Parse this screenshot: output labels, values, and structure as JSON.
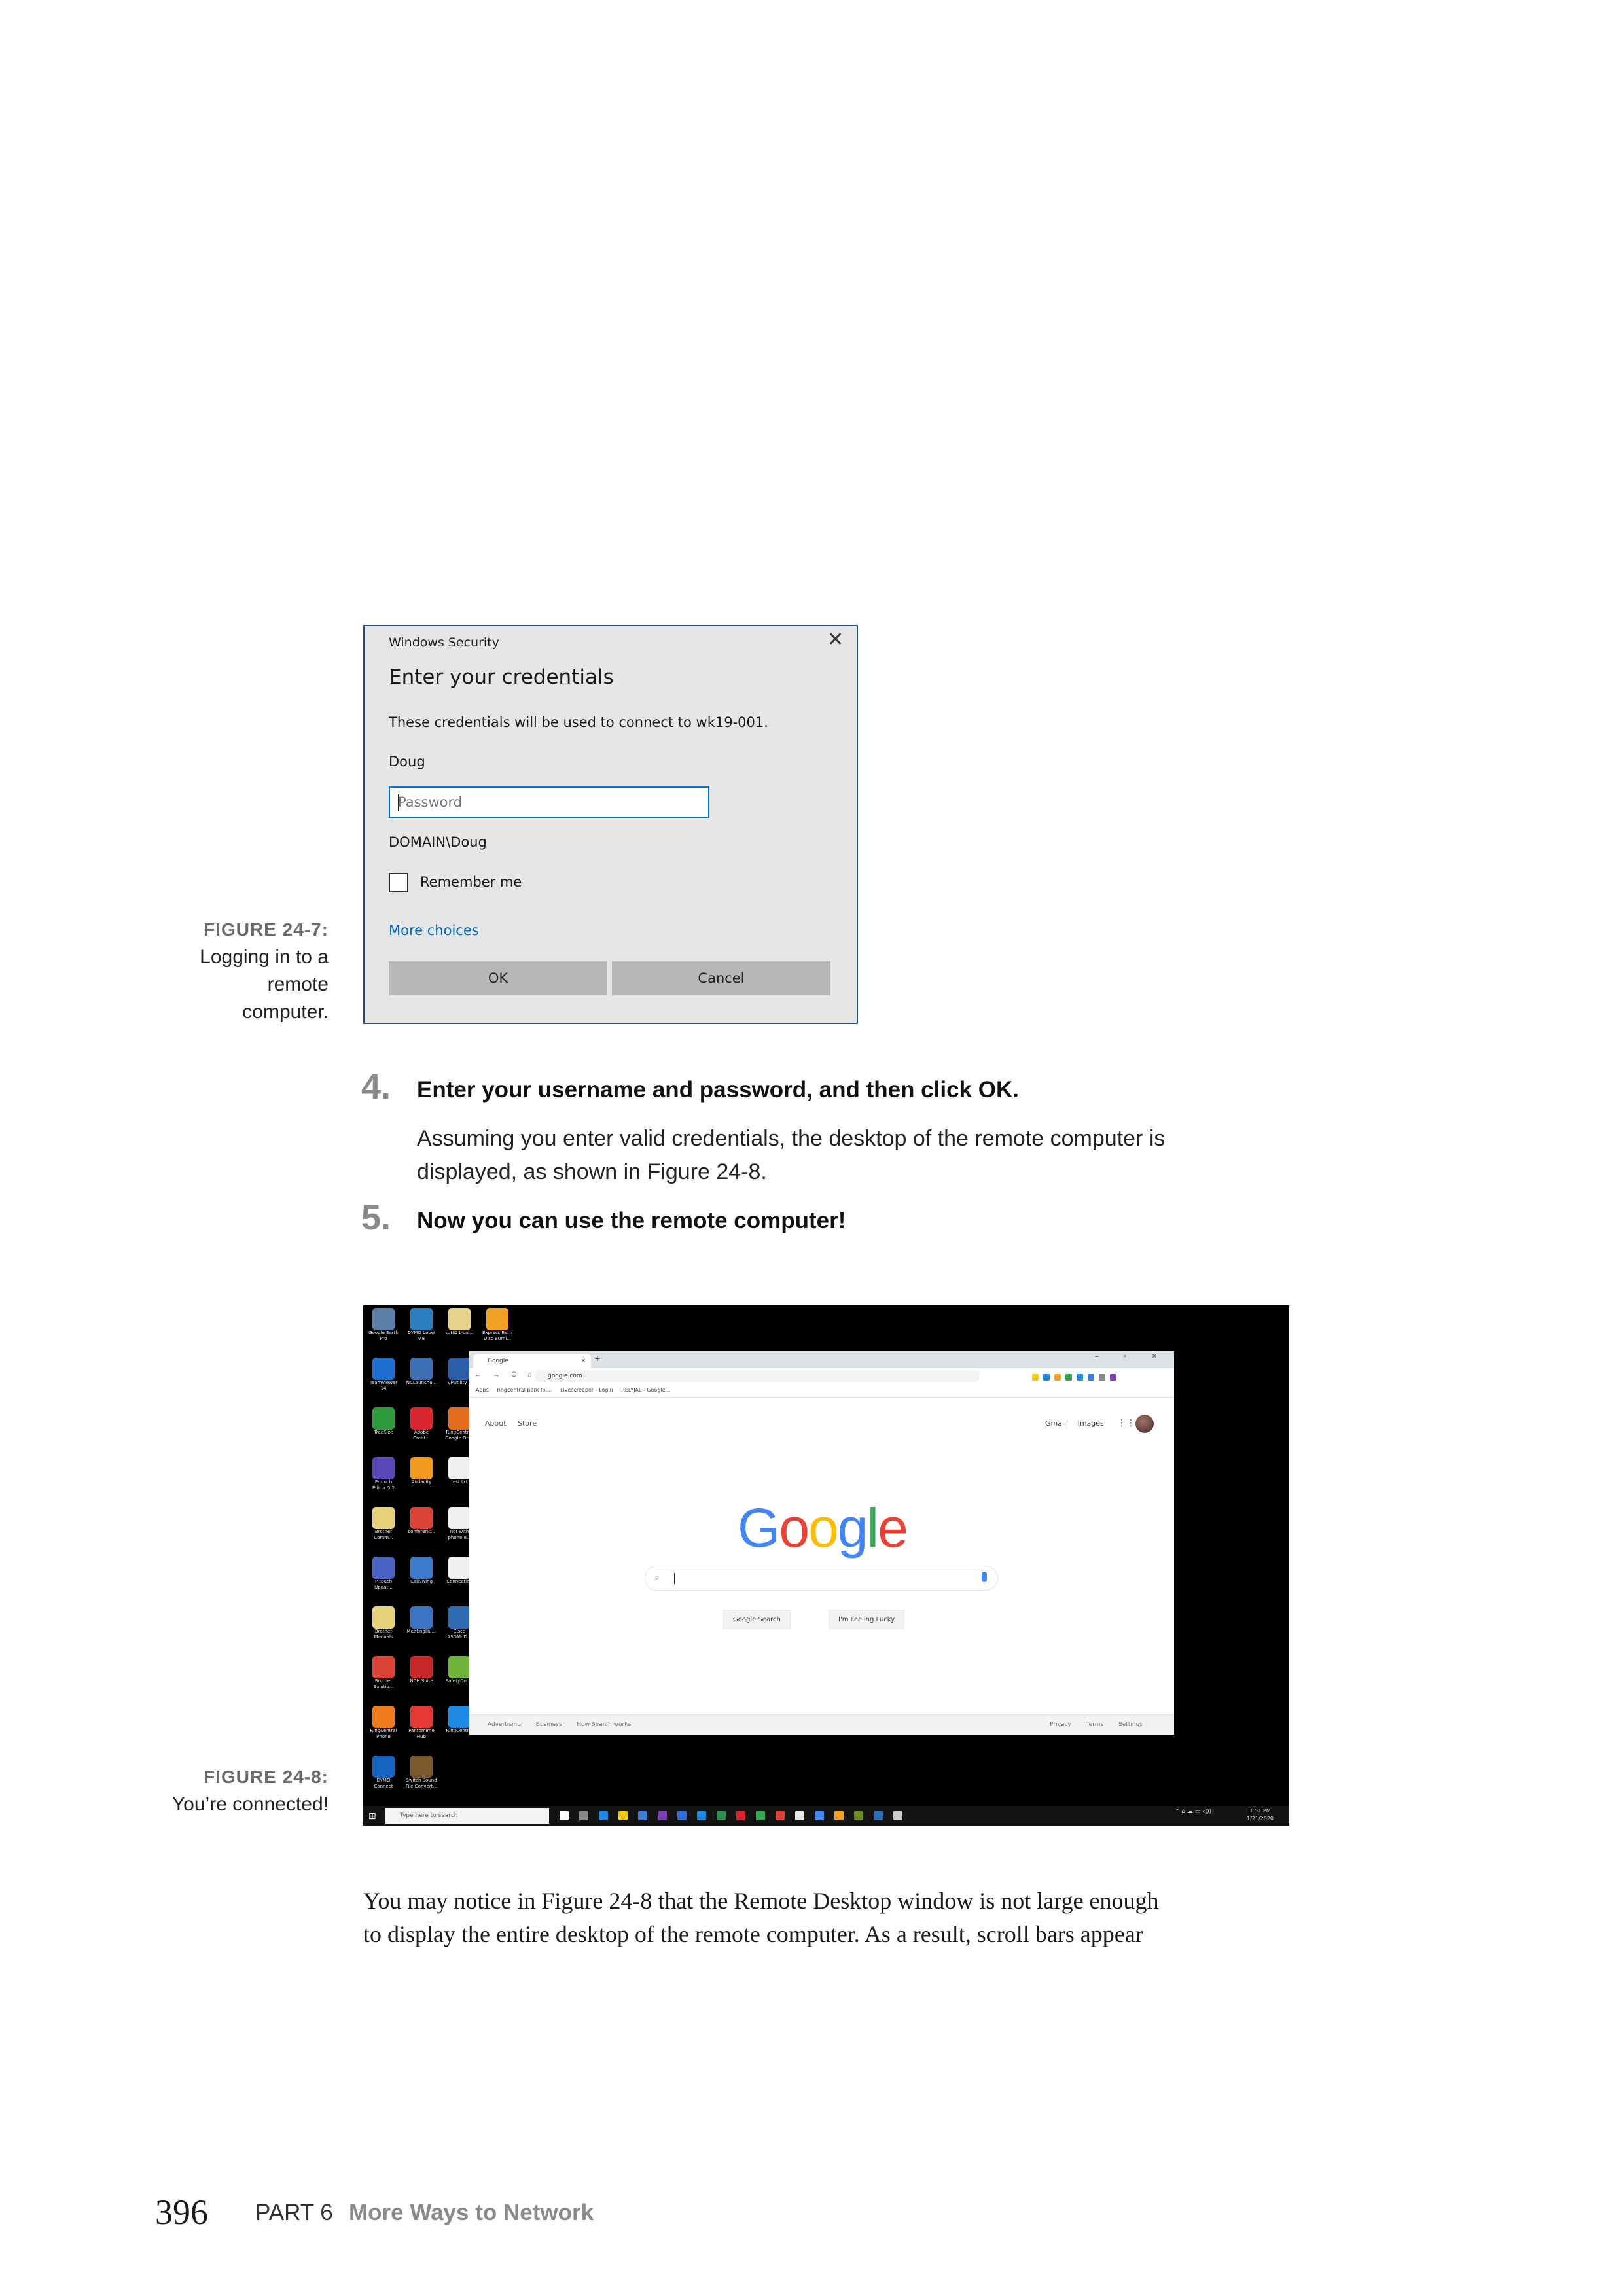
{
  "figure_24_7": {
    "label": "FIGURE 24-7:",
    "caption_lines": [
      "Logging in to a",
      "remote",
      "computer."
    ],
    "dialog": {
      "title": "Windows Security",
      "close_glyph": "✕",
      "heading": "Enter your credentials",
      "description": "These credentials will be used to connect to wk19-001.",
      "username": "Doug",
      "password_placeholder": "Password",
      "domain_user": "DOMAIN\\Doug",
      "remember_label": "Remember me",
      "more_choices": "More choices",
      "ok_label": "OK",
      "cancel_label": "Cancel"
    }
  },
  "steps": [
    {
      "num": "4.",
      "text": "Enter your username and password, and then click OK.",
      "detail_lines": [
        "Assuming you enter valid credentials, the desktop of the remote computer is",
        "displayed, as shown in Figure 24-8."
      ]
    },
    {
      "num": "5.",
      "text": "Now you can use the remote computer!"
    }
  ],
  "figure_24_8": {
    "label": "FIGURE 24-8:",
    "caption": "You’re connected!",
    "desktop_icons": [
      {
        "label": "Google Earth\nPro",
        "color": "#5b7fa8"
      },
      {
        "label": "DYMO Label\nv.8",
        "color": "#2e7fc2"
      },
      {
        "label": "sqt021-cal...",
        "color": "#e6d38a"
      },
      {
        "label": "Express Burn\nDisc Burni...",
        "color": "#f2a127"
      },
      {
        "label": "TeamViewer\n14",
        "color": "#1f6fd1"
      },
      {
        "label": "NCLaunche...",
        "color": "#3d6fb5"
      },
      {
        "label": "VPUtility 2",
        "color": "#2b5ea8"
      },
      {
        "label": "TreeSize",
        "color": "#2e9b3c"
      },
      {
        "label": "Adobe\nCreat...",
        "color": "#d9262e"
      },
      {
        "label": "RingCentral\nGoogle Dri...",
        "color": "#e36f1e"
      },
      {
        "label": "P-touch\nEditor 5.2",
        "color": "#5b48b8"
      },
      {
        "label": "Audacity",
        "color": "#f29a1d"
      },
      {
        "label": "test.txt",
        "color": "#f0f0f0"
      },
      {
        "label": "Brother\nComm...",
        "color": "#e8d27a"
      },
      {
        "label": "conferenc...",
        "color": "#db4437"
      },
      {
        "label": "not with\nphone e...",
        "color": "#f0f0f0"
      },
      {
        "label": "P-touch\nUpdat...",
        "color": "#4a62c4"
      },
      {
        "label": "CallSwing",
        "color": "#3d7ac9"
      },
      {
        "label": "Connection",
        "color": "#f0f0f0"
      },
      {
        "label": "Brother\nManuals",
        "color": "#e8d27a"
      },
      {
        "label": "MeetingHu...",
        "color": "#3a74c2"
      },
      {
        "label": "Cisco\nASDM-ID...",
        "color": "#2e6bb2"
      },
      {
        "label": "Brother\nSolutio...",
        "color": "#db4437"
      },
      {
        "label": "NCH Suite",
        "color": "#c62828"
      },
      {
        "label": "SafetyDoc...",
        "color": "#6fb33a"
      },
      {
        "label": "RingCentral\nPhone",
        "color": "#f07c1e"
      },
      {
        "label": "Pantomime\nHub",
        "color": "#e53935"
      },
      {
        "label": "RingCentral",
        "color": "#1e88e5"
      },
      {
        "label": "DYMO\nConnect",
        "color": "#1565c0"
      },
      {
        "label": "Switch Sound\nFile Convert...",
        "color": "#7d5a2e"
      }
    ],
    "browser": {
      "tab_label": "Google",
      "tab_close": "×",
      "new_tab": "+",
      "window_controls": "– ▫ ✕",
      "nav": "← → C ⌂",
      "url": "google.com",
      "bookmarks": [
        "Apps",
        "ringcentral park fol...",
        "Livescreeper - Login",
        "RELYJAL - Google..."
      ],
      "top_left_links": [
        "About",
        "Store"
      ],
      "top_right_links": [
        "Gmail",
        "Images"
      ],
      "apps_glyph": "⋮⋮⋮",
      "logo_letters": [
        {
          "ch": "G",
          "color": "#4285f4"
        },
        {
          "ch": "o",
          "color": "#ea4335"
        },
        {
          "ch": "o",
          "color": "#fbbc05"
        },
        {
          "ch": "g",
          "color": "#4285f4"
        },
        {
          "ch": "l",
          "color": "#34a853"
        },
        {
          "ch": "e",
          "color": "#ea4335"
        }
      ],
      "search_button": "Google Search",
      "lucky_button": "I'm Feeling Lucky",
      "footer_left": [
        "Advertising",
        "Business",
        "How Search works"
      ],
      "footer_right": [
        "Privacy",
        "Terms",
        "Settings"
      ]
    },
    "taskbar": {
      "start_glyph": "⊞",
      "search_placeholder": "Type here to search",
      "tray": "^ ⌂ ☁ ▭ ◁))",
      "time": "1:51 PM",
      "date": "1/21/2020",
      "app_colors": [
        "#ffffff",
        "#888888",
        "#1e88e5",
        "#f2c811",
        "#3b7dd8",
        "#7b3fb5",
        "#2f6fd6",
        "#1e88e5",
        "#2d8f4e",
        "#d9262e",
        "#34a853",
        "#db4437",
        "#e8e8e8",
        "#4285f4",
        "#f2a127",
        "#6b8e23",
        "#2d6fb5",
        "#cccccc"
      ]
    }
  },
  "body_paragraph_lines": [
    "You may notice in Figure 24-8 that the Remote Desktop window is not large enough",
    "to display the entire desktop of the remote computer. As a result, scroll bars appear"
  ],
  "footer": {
    "page_number": "396",
    "part": "PART 6",
    "part_title": "More Ways to Network"
  }
}
